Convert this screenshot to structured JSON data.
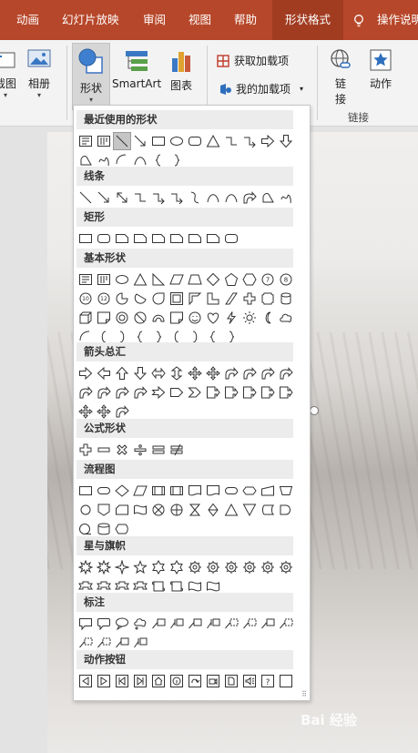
{
  "tabs": [
    {
      "label": "动画",
      "active": false
    },
    {
      "label": "幻灯片放映",
      "active": false
    },
    {
      "label": "审阅",
      "active": false
    },
    {
      "label": "视图",
      "active": false
    },
    {
      "label": "帮助",
      "active": false
    },
    {
      "label": "形状格式",
      "active": true
    },
    {
      "label": "操作说明",
      "active": false
    }
  ],
  "ribbon": {
    "screenshot_label": "截图",
    "album_label": "相册",
    "shapes_label": "形状",
    "smartart_label": "SmartArt",
    "chart_label": "图表",
    "get_addins_label": "获取加载项",
    "my_addins_label": "我的加载项",
    "link_label_1": "链",
    "link_label_2": "接",
    "action_label": "动作",
    "links_group_label": "链接"
  },
  "shapes_panel": {
    "sections": [
      {
        "title": "最近使用的形状"
      },
      {
        "title": "线条"
      },
      {
        "title": "矩形"
      },
      {
        "title": "基本形状"
      },
      {
        "title": "箭头总汇"
      },
      {
        "title": "公式形状"
      },
      {
        "title": "流程图"
      },
      {
        "title": "星与旗帜"
      },
      {
        "title": "标注"
      },
      {
        "title": "动作按钮"
      }
    ]
  },
  "watermark": "Bai 经验",
  "colors": {
    "ribbon_tab_bg": "#b7472a",
    "active_tab_bg": "#a23c21",
    "panel_header_bg": "#ececec"
  }
}
